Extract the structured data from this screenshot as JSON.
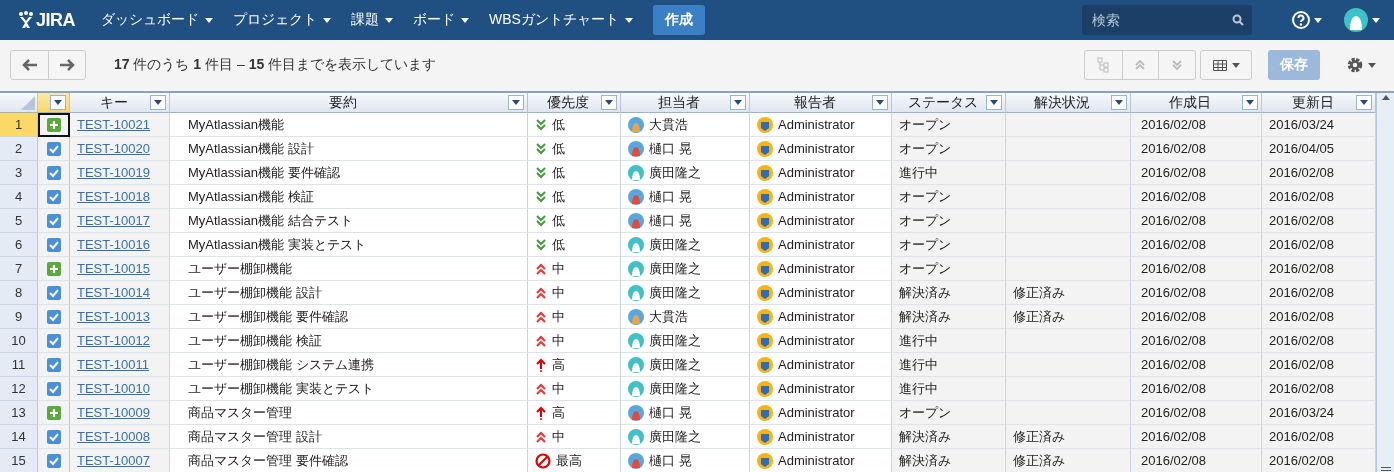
{
  "nav": {
    "logo": "JIRA",
    "menus": [
      {
        "label": "ダッシュボード"
      },
      {
        "label": "プロジェクト"
      },
      {
        "label": "課題"
      },
      {
        "label": "ボード"
      },
      {
        "label": "WBSガントチャート"
      }
    ],
    "create": "作成",
    "search": {
      "placeholder": "検索"
    }
  },
  "toolbar": {
    "summary": "**17** 件のうち **1** 件目 – **15** 件目までを表示しています",
    "save": {
      "label": "保存",
      "disabled": true
    }
  },
  "grid": {
    "columns": [
      {
        "label": "キー"
      },
      {
        "label": "要約"
      },
      {
        "label": "優先度"
      },
      {
        "label": "担当者"
      },
      {
        "label": "報告者"
      },
      {
        "label": "ステータス"
      },
      {
        "label": "解決状況"
      },
      {
        "label": "作成日"
      },
      {
        "label": "更新日"
      }
    ],
    "rows": [
      {
        "number": "1",
        "selected": true,
        "kind": "story",
        "key": "TEST-10021",
        "summary": "MyAtlassian機能",
        "priority": {
          "kind": "low",
          "label": "低"
        },
        "assignee": {
          "kind": "helmet",
          "name": "大貫浩"
        },
        "reporter": "Administrator",
        "status": "オープン",
        "created": "2016/02/08",
        "updated": "2016/03/24"
      },
      {
        "number": "2",
        "selected": false,
        "kind": "subtask",
        "key": "TEST-10020",
        "summary": "MyAtlassian機能 設計",
        "priority": {
          "kind": "low",
          "label": "低"
        },
        "assignee": {
          "kind": "cap",
          "name": "樋口 晃"
        },
        "reporter": "Administrator",
        "status": "オープン",
        "created": "2016/02/08",
        "updated": "2016/04/05"
      },
      {
        "number": "3",
        "selected": false,
        "kind": "subtask",
        "key": "TEST-10019",
        "summary": "MyAtlassian機能 要件確認",
        "priority": {
          "kind": "low",
          "label": "低"
        },
        "assignee": {
          "kind": "ghost",
          "name": "廣田隆之"
        },
        "reporter": "Administrator",
        "status": "進行中",
        "created": "2016/02/08",
        "updated": "2016/02/08"
      },
      {
        "number": "4",
        "selected": false,
        "kind": "subtask",
        "key": "TEST-10018",
        "summary": "MyAtlassian機能 検証",
        "priority": {
          "kind": "low",
          "label": "低"
        },
        "assignee": {
          "kind": "cap",
          "name": "樋口 晃"
        },
        "reporter": "Administrator",
        "status": "オープン",
        "created": "2016/02/08",
        "updated": "2016/02/08"
      },
      {
        "number": "5",
        "selected": false,
        "kind": "subtask",
        "key": "TEST-10017",
        "summary": "MyAtlassian機能 結合テスト",
        "priority": {
          "kind": "low",
          "label": "低"
        },
        "assignee": {
          "kind": "cap",
          "name": "樋口 晃"
        },
        "reporter": "Administrator",
        "status": "オープン",
        "created": "2016/02/08",
        "updated": "2016/02/08"
      },
      {
        "number": "6",
        "selected": false,
        "kind": "subtask",
        "key": "TEST-10016",
        "summary": "MyAtlassian機能 実装とテスト",
        "priority": {
          "kind": "low",
          "label": "低"
        },
        "assignee": {
          "kind": "ghost",
          "name": "廣田隆之"
        },
        "reporter": "Administrator",
        "status": "オープン",
        "created": "2016/02/08",
        "updated": "2016/02/08"
      },
      {
        "number": "7",
        "selected": false,
        "kind": "story",
        "key": "TEST-10015",
        "summary": "ユーザー棚卸機能",
        "priority": {
          "kind": "medium",
          "label": "中"
        },
        "assignee": {
          "kind": "ghost",
          "name": "廣田隆之"
        },
        "reporter": "Administrator",
        "status": "オープン",
        "created": "2016/02/08",
        "updated": "2016/02/08"
      },
      {
        "number": "8",
        "selected": false,
        "kind": "subtask",
        "key": "TEST-10014",
        "summary": "ユーザー棚卸機能 設計",
        "priority": {
          "kind": "medium",
          "label": "中"
        },
        "assignee": {
          "kind": "ghost",
          "name": "廣田隆之"
        },
        "reporter": "Administrator",
        "status": "解決済み",
        "resolution": "修正済み",
        "created": "2016/02/08",
        "updated": "2016/02/08"
      },
      {
        "number": "9",
        "selected": false,
        "kind": "subtask",
        "key": "TEST-10013",
        "summary": "ユーザー棚卸機能 要件確認",
        "priority": {
          "kind": "medium",
          "label": "中"
        },
        "assignee": {
          "kind": "helmet",
          "name": "大貫浩"
        },
        "reporter": "Administrator",
        "status": "解決済み",
        "resolution": "修正済み",
        "created": "2016/02/08",
        "updated": "2016/02/08"
      },
      {
        "number": "10",
        "selected": false,
        "kind": "subtask",
        "key": "TEST-10012",
        "summary": "ユーザー棚卸機能 検証",
        "priority": {
          "kind": "medium",
          "label": "中"
        },
        "assignee": {
          "kind": "ghost",
          "name": "廣田隆之"
        },
        "reporter": "Administrator",
        "status": "進行中",
        "created": "2016/02/08",
        "updated": "2016/02/08"
      },
      {
        "number": "11",
        "selected": false,
        "kind": "subtask",
        "key": "TEST-10011",
        "summary": "ユーザー棚卸機能 システム連携",
        "priority": {
          "kind": "high",
          "label": "高"
        },
        "assignee": {
          "kind": "ghost",
          "name": "廣田隆之"
        },
        "reporter": "Administrator",
        "status": "進行中",
        "created": "2016/02/08",
        "updated": "2016/02/08"
      },
      {
        "number": "12",
        "selected": false,
        "kind": "subtask",
        "key": "TEST-10010",
        "summary": "ユーザー棚卸機能 実装とテスト",
        "priority": {
          "kind": "medium",
          "label": "中"
        },
        "assignee": {
          "kind": "ghost",
          "name": "廣田隆之"
        },
        "reporter": "Administrator",
        "status": "進行中",
        "created": "2016/02/08",
        "updated": "2016/02/08"
      },
      {
        "number": "13",
        "selected": false,
        "kind": "story",
        "key": "TEST-10009",
        "summary": "商品マスター管理",
        "priority": {
          "kind": "high",
          "label": "高"
        },
        "assignee": {
          "kind": "cap",
          "name": "樋口 晃"
        },
        "reporter": "Administrator",
        "status": "オープン",
        "created": "2016/02/08",
        "updated": "2016/03/24"
      },
      {
        "number": "14",
        "selected": false,
        "kind": "subtask",
        "key": "TEST-10008",
        "summary": "商品マスター管理 設計",
        "priority": {
          "kind": "medium",
          "label": "中"
        },
        "assignee": {
          "kind": "ghost",
          "name": "廣田隆之"
        },
        "reporter": "Administrator",
        "status": "解決済み",
        "resolution": "修正済み",
        "created": "2016/02/08",
        "updated": "2016/02/08"
      },
      {
        "number": "15",
        "selected": false,
        "kind": "subtask",
        "key": "TEST-10007",
        "summary": "商品マスター管理 要件確認",
        "priority": {
          "kind": "highest",
          "label": "最高"
        },
        "assignee": {
          "kind": "cap",
          "name": "樋口 晃"
        },
        "reporter": "Administrator",
        "status": "解決済み",
        "resolution": "修正済み",
        "created": "2016/02/08",
        "updated": "2016/02/08"
      }
    ]
  }
}
